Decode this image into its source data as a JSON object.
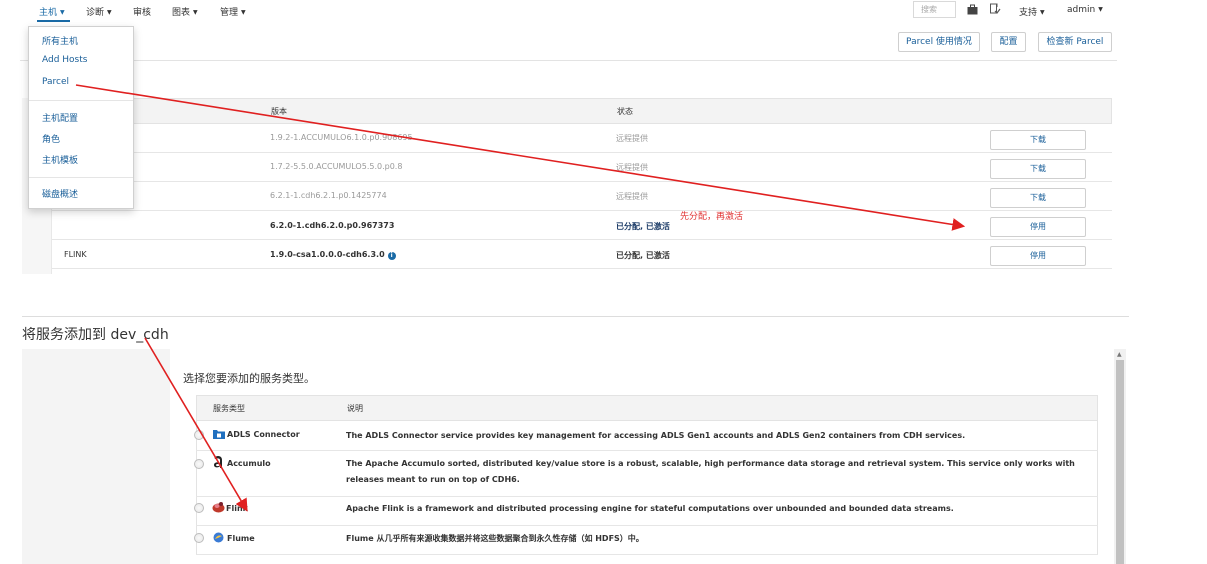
{
  "topnav": {
    "items": [
      {
        "label": "主机"
      },
      {
        "label": "诊断"
      },
      {
        "label": "审核"
      },
      {
        "label": "图表"
      },
      {
        "label": "管理"
      }
    ],
    "search_placeholder": "搜索",
    "support": "支持",
    "user": "admin"
  },
  "dropdown": {
    "items": [
      "所有主机",
      "Add Hosts",
      "Parcel",
      "主机配置",
      "角色",
      "主机模板",
      "磁盘概述"
    ]
  },
  "toolbar": {
    "parcel_usage": "Parcel 使用情况",
    "config": "配置",
    "check_new": "检查新 Parcel"
  },
  "parcel_table": {
    "headers": {
      "version": "版本",
      "status": "状态"
    },
    "rows": [
      {
        "name": "",
        "version": "1.9.2-1.ACCUMULO6.1.0.p0.908695",
        "status": "远程提供",
        "action": "下载"
      },
      {
        "name": "",
        "version": "1.7.2-5.5.0.ACCUMULO5.5.0.p0.8",
        "status": "远程提供",
        "action": "下载"
      },
      {
        "name": "",
        "version": "6.2.1-1.cdh6.2.1.p0.1425774",
        "status": "远程提供",
        "action": "下载"
      },
      {
        "name": "",
        "version": "6.2.0-1.cdh6.2.0.p0.967373",
        "status": "已分配, 已激活",
        "action": "停用"
      },
      {
        "name": "FLINK",
        "version": "1.9.0-csa1.0.0.0-cdh6.3.0",
        "status": "已分配, 已激活",
        "action": "停用"
      }
    ]
  },
  "annotation": "先分配，再激活",
  "add_service": {
    "title": "将服务添加到 dev_cdh",
    "subtitle": "选择您要添加的服务类型。",
    "headers": {
      "type": "服务类型",
      "desc": "说明"
    },
    "services": [
      {
        "name": "ADLS Connector",
        "desc": "The ADLS Connector service provides key management for accessing ADLS Gen1 accounts and ADLS Gen2 containers from CDH services."
      },
      {
        "name": "Accumulo",
        "desc": "The Apache Accumulo sorted, distributed key/value store is a robust, scalable, high performance data storage and retrieval system. This service only works with releases meant to run on top of CDH6."
      },
      {
        "name": "Flink",
        "desc": "Apache Flink is a framework and distributed processing engine for stateful computations over unbounded and bounded data streams."
      },
      {
        "name": "Flume",
        "desc": "Flume 从几乎所有来源收集数据并将这些数据聚合到永久性存储（如 HDFS）中。"
      }
    ]
  },
  "colors": {
    "link": "#1a5f99",
    "accent": "#1a6aa6",
    "annotation": "#e03030"
  },
  "icons": [
    "caret-down-icon",
    "briefcase-icon",
    "tasks-icon",
    "info-icon",
    "folder-icon",
    "accumulo-icon",
    "flink-icon",
    "flume-icon"
  ]
}
